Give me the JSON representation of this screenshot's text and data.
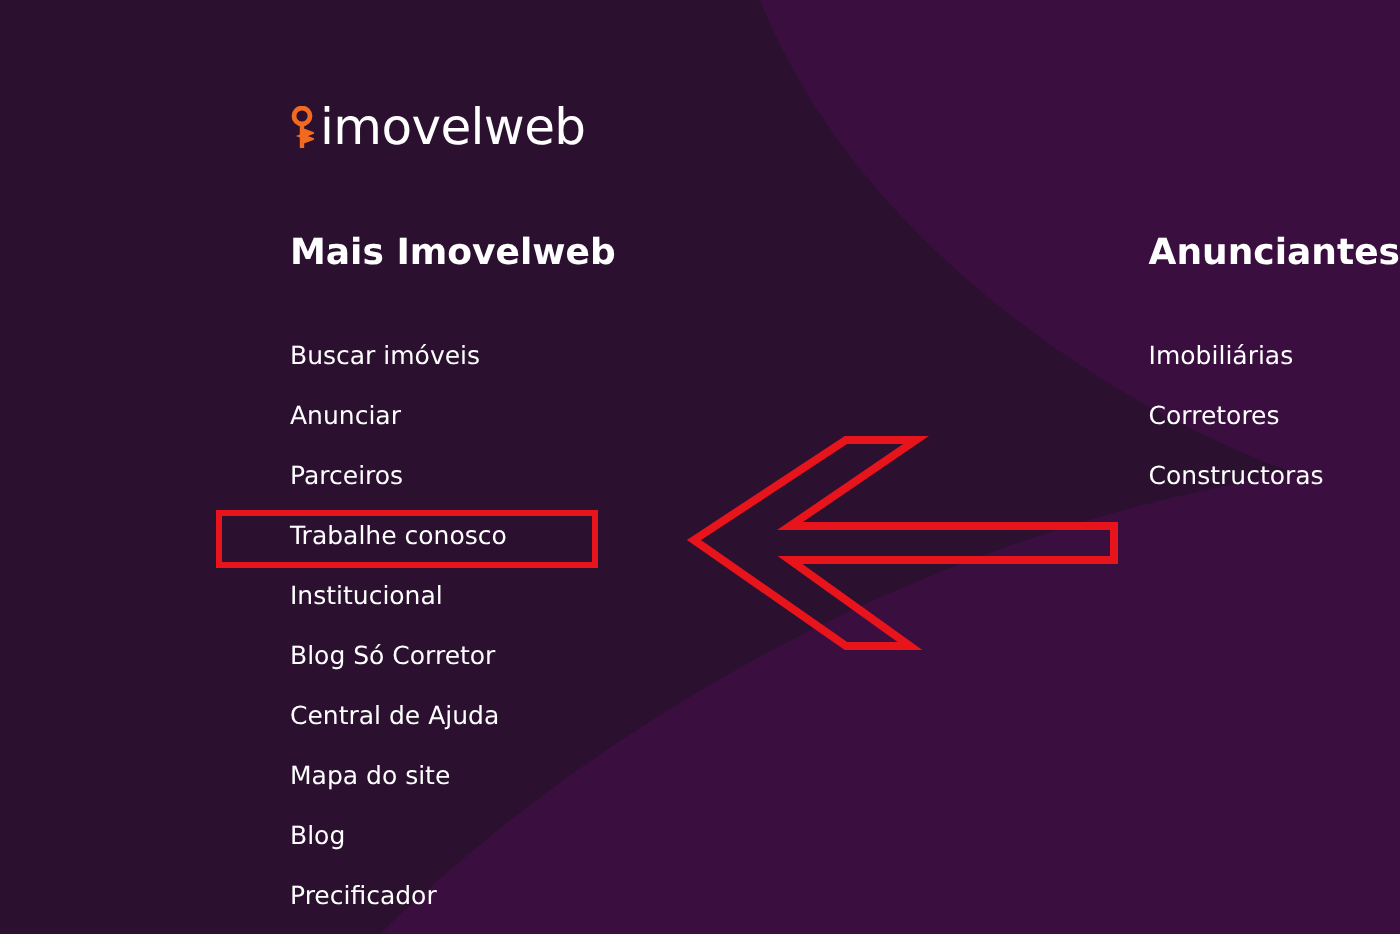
{
  "logo": {
    "text": "imovelweb"
  },
  "columns": [
    {
      "heading": "Mais Imovelweb",
      "links": [
        {
          "label": "Buscar imóveis",
          "highlighted": false
        },
        {
          "label": "Anunciar",
          "highlighted": false
        },
        {
          "label": "Parceiros",
          "highlighted": false
        },
        {
          "label": "Trabalhe conosco",
          "highlighted": true
        },
        {
          "label": "Institucional",
          "highlighted": false
        },
        {
          "label": "Blog Só Corretor",
          "highlighted": false
        },
        {
          "label": "Central de Ajuda",
          "highlighted": false
        },
        {
          "label": "Mapa do site",
          "highlighted": false
        },
        {
          "label": "Blog",
          "highlighted": false
        },
        {
          "label": "Precificador",
          "highlighted": false
        }
      ]
    },
    {
      "heading": "Anunciantes",
      "links": [
        {
          "label": "Imobiliárias",
          "highlighted": false
        },
        {
          "label": "Corretores",
          "highlighted": false
        },
        {
          "label": "Constructoras",
          "highlighted": false
        }
      ]
    }
  ]
}
